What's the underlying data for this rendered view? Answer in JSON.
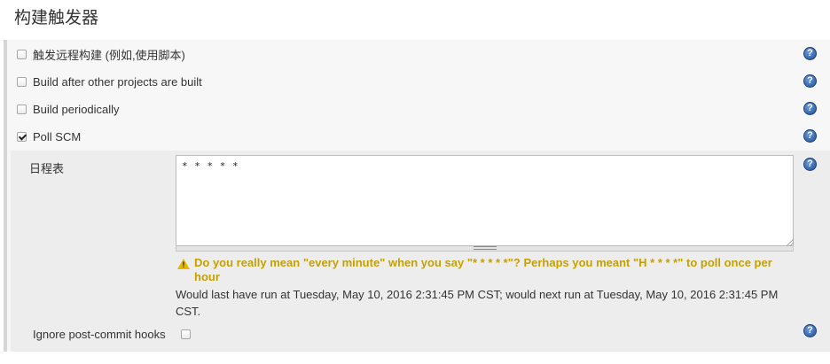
{
  "section": {
    "title": "构建触发器"
  },
  "triggers": [
    {
      "label": "触发远程构建 (例如,使用脚本)",
      "checked": false
    },
    {
      "label": "Build after other projects are built",
      "checked": false
    },
    {
      "label": "Build periodically",
      "checked": false
    },
    {
      "label": "Poll SCM",
      "checked": true
    }
  ],
  "poll_scm": {
    "schedule_label": "日程表",
    "schedule_value": "* * * * *",
    "warning": "Do you really mean \"every minute\" when you say \"* * * * *\"? Perhaps you meant \"H * * * *\" to poll once per hour",
    "info": "Would last have run at Tuesday, May 10, 2016 2:31:45 PM CST; would next run at Tuesday, May 10, 2016 2:31:45 PM CST.",
    "ignore_label": "Ignore post-commit hooks",
    "ignore_checked": false
  },
  "help_symbol": "?",
  "colors": {
    "help": "#204f9b",
    "warning": "#c4a000"
  }
}
